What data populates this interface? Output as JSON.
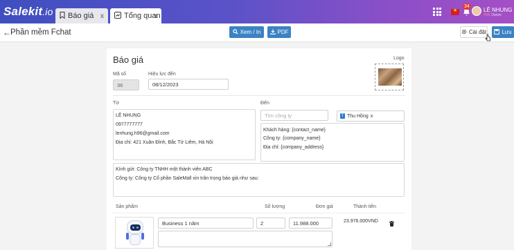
{
  "app": {
    "logo_main": "Salekit",
    "logo_suffix": ".io",
    "tabs": [
      {
        "label": "Báo giá",
        "icon": "bookmark-icon",
        "close": "x"
      },
      {
        "label": "Tổng quan",
        "icon": "dashboard-icon",
        "close": "x"
      }
    ],
    "notification_count": "34",
    "user": {
      "name": "LÊ NHUNG",
      "status": "FRE",
      "role": "Owner"
    }
  },
  "subbar": {
    "back_arrow": "←",
    "page_title": "Phần mềm Fchat",
    "view_button": "Xem / In",
    "pdf_button": "PDF",
    "settings_button": "Cài đặt",
    "save_button": "Lưu"
  },
  "quote": {
    "title": "Báo giá",
    "code_label": "Mã số",
    "code_value": "36",
    "valid_label": "Hiệu lực đến",
    "valid_value": "08/12/2023",
    "logo_label": "Logo",
    "from_label": "Từ",
    "to_label": "Đến",
    "from_lines": [
      "LÊ NHUNG",
      "0977777777",
      "lenhung.h96@gmail.com",
      "Địa chỉ: 421 Xuân Đỉnh, Bắc Từ Liêm, Hà Nội"
    ],
    "company_placeholder": "Tìm công ty",
    "contact_tag": "Thu Hồng",
    "contact_tag_close": "x",
    "to_lines": [
      "Khách hàng: {contact_name}",
      "Công ty: {company_name}",
      "Địa chỉ: {company_address}"
    ],
    "intro_lines": [
      "Kính gửi: Công ty TNHH một thành viên ABC",
      "Công ty: Công ty Cổ phần SaleMall xin trân trọng báo giá như sau:"
    ]
  },
  "table": {
    "headers": [
      "Sản phẩm",
      "Số lượng",
      "Đơn giá",
      "Thành tiền"
    ],
    "rows": [
      {
        "name": "Business 1 năm",
        "quantity": "2",
        "unit_price": "11.988.000",
        "total": "23.976.000VND"
      }
    ]
  },
  "colors": {
    "primary": "#3b82c4",
    "header_gradient_start": "#3f4fc0",
    "header_gradient_end": "#a54fc5"
  }
}
